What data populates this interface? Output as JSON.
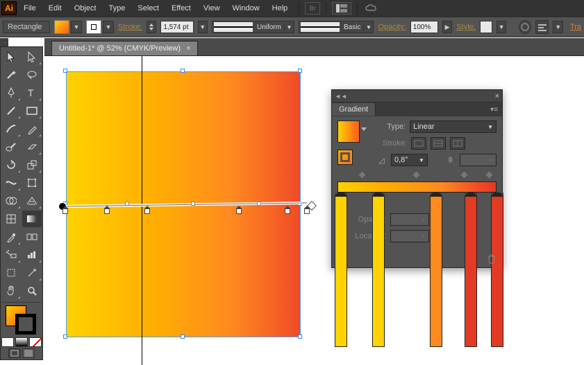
{
  "menu": {
    "items": [
      "File",
      "Edit",
      "Object",
      "Type",
      "Select",
      "Effect",
      "View",
      "Window",
      "Help"
    ],
    "br": "Br"
  },
  "control": {
    "shape": "Rectangle",
    "stroke_label": "Stroke:",
    "stroke_weight": "1,574 pt",
    "profile_label": "Uniform",
    "brush_label": "Basic",
    "opacity_label": "Opacity:",
    "opacity_value": "100%",
    "style_label": "Style:",
    "transform_label": "Tra"
  },
  "document": {
    "tab_title": "Untitled-1* @ 52% (CMYK/Preview)"
  },
  "gradient_panel": {
    "title": "Gradient",
    "type_label": "Type:",
    "type_value": "Linear",
    "stroke_label": "Stroke:",
    "angle_value": "0,8°",
    "opacity_label": "Opacity:",
    "opacity_value": "",
    "location_label": "Location:",
    "location_value": ""
  },
  "chart_data": {
    "type": "gradient",
    "angle_deg": 0.8,
    "stops": [
      {
        "position_pct": 0,
        "color": "#ffd200"
      },
      {
        "position_pct": 25,
        "color": "#ffb000"
      },
      {
        "position_pct": 65,
        "color": "#ff8a1f"
      },
      {
        "position_pct": 90,
        "color": "#f04a28"
      },
      {
        "position_pct": 100,
        "color": "#e23a24"
      }
    ]
  }
}
